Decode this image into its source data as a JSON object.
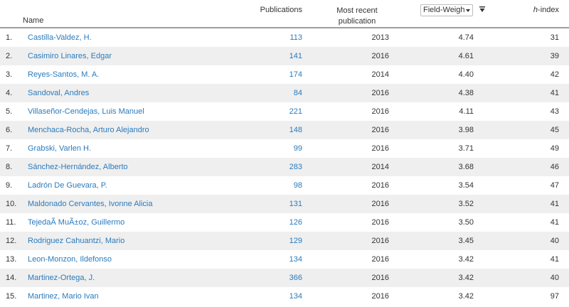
{
  "header": {
    "name_label": "Name",
    "publications_label": "Publications",
    "recent_line1": "Most recent",
    "recent_line2": "publication",
    "fwci_label": "Field-Weighted Citation Impact",
    "hindex_h": "h",
    "hindex_suffix": "-index"
  },
  "rows": [
    {
      "idx": "1.",
      "name": "Castilla-Valdez, H.",
      "pubs": "113",
      "year": "2013",
      "fwci": "4.74",
      "h": "31"
    },
    {
      "idx": "2.",
      "name": "Casimiro Linares, Edgar",
      "pubs": "141",
      "year": "2016",
      "fwci": "4.61",
      "h": "39"
    },
    {
      "idx": "3.",
      "name": "Reyes-Santos, M. A.",
      "pubs": "174",
      "year": "2014",
      "fwci": "4.40",
      "h": "42"
    },
    {
      "idx": "4.",
      "name": "Sandoval, Andres",
      "pubs": "84",
      "year": "2016",
      "fwci": "4.38",
      "h": "41"
    },
    {
      "idx": "5.",
      "name": "Villaseñor-Cendejas, Luis Manuel",
      "pubs": "221",
      "year": "2016",
      "fwci": "4.11",
      "h": "43"
    },
    {
      "idx": "6.",
      "name": "Menchaca-Rocha, Arturo Alejandro",
      "pubs": "148",
      "year": "2016",
      "fwci": "3.98",
      "h": "45"
    },
    {
      "idx": "7.",
      "name": "Grabski, Varlen H.",
      "pubs": "99",
      "year": "2016",
      "fwci": "3.71",
      "h": "49"
    },
    {
      "idx": "8.",
      "name": "Sánchez-Hernández, Alberto",
      "pubs": "283",
      "year": "2014",
      "fwci": "3.68",
      "h": "46"
    },
    {
      "idx": "9.",
      "name": "Ladrón De Guevara, P.",
      "pubs": "98",
      "year": "2016",
      "fwci": "3.54",
      "h": "47"
    },
    {
      "idx": "10.",
      "name": "Maldonado Cervantes, Ivonne Alicia",
      "pubs": "131",
      "year": "2016",
      "fwci": "3.52",
      "h": "41"
    },
    {
      "idx": "11.",
      "name": "TejedaÃ MuÃ±oz, Guillermo",
      "pubs": "126",
      "year": "2016",
      "fwci": "3.50",
      "h": "41"
    },
    {
      "idx": "12.",
      "name": "Rodriguez Cahuantzi, Mario",
      "pubs": "129",
      "year": "2016",
      "fwci": "3.45",
      "h": "40"
    },
    {
      "idx": "13.",
      "name": "Leon-Monzon, Ildefonso",
      "pubs": "134",
      "year": "2016",
      "fwci": "3.42",
      "h": "41"
    },
    {
      "idx": "14.",
      "name": "Martinez-Ortega, J.",
      "pubs": "366",
      "year": "2016",
      "fwci": "3.42",
      "h": "40"
    },
    {
      "idx": "15.",
      "name": "Martinez, Mario Ivan",
      "pubs": "134",
      "year": "2016",
      "fwci": "3.42",
      "h": "97"
    }
  ]
}
